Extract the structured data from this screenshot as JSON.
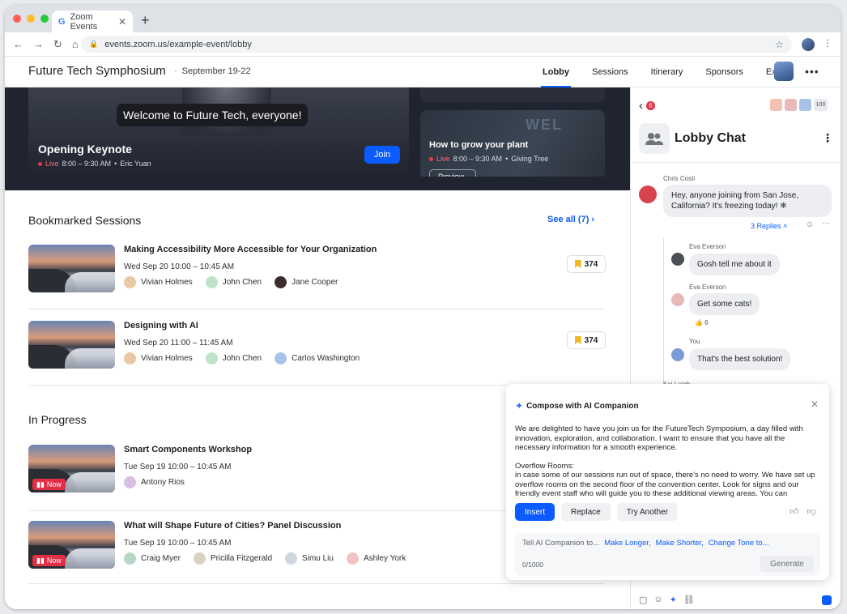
{
  "browser": {
    "tab_title": "Zoom Events",
    "url": "events.zoom.us/example-event/lobby"
  },
  "header": {
    "event_title": "Future Tech Symphosium",
    "event_date": "September 19-22",
    "nav": [
      "Lobby",
      "Sessions",
      "Itinerary",
      "Sponsors",
      "Expo"
    ]
  },
  "hero": {
    "caption": "Welcome to Future Tech, everyone!",
    "title": "Opening Keynote",
    "live": "Live",
    "time": "8:00 – 9:30 AM",
    "host": "Eric Yuan",
    "join_label": "Join",
    "side_title": "How to grow your plant",
    "side_time": "8:00 – 9:30 AM",
    "side_host": "Giving Tree",
    "side_button": "Preview",
    "side_watermark": "WEL"
  },
  "bookmarked": {
    "title": "Bookmarked Sessions",
    "see_all": "See all (7)",
    "items": [
      {
        "title": "Making Accessibility More Accessible for Your Organization",
        "date": "Wed Sep 20 10:00 – 10:45 AM",
        "count": "374",
        "people": [
          "Vivian Holmes",
          "John Chen",
          "Jane Cooper"
        ]
      },
      {
        "title": "Designing with AI",
        "date": "Wed Sep 20 11:00 – 11:45 AM",
        "count": "374",
        "people": [
          "Vivian Holmes",
          "John Chen",
          "Carlos Washington"
        ]
      }
    ]
  },
  "in_progress": {
    "title": "In Progress",
    "now_label": "Now",
    "items": [
      {
        "title": "Smart Components Workshop",
        "date": "Tue Sep 19 10:00 – 10:45 AM",
        "people": [
          "Antony Rios"
        ]
      },
      {
        "title": "What will Shape Future of Cities? Panel Discussion",
        "date": "Tue Sep 19 10:00 – 10:45 AM",
        "people": [
          "Craig Myer",
          "Pricilla Fitzgerald",
          "Simu Liu",
          "Ashley York"
        ]
      }
    ]
  },
  "chat": {
    "unread": "6",
    "member_count": "100",
    "name": "Lobby Chat",
    "messages": {
      "m1_sender": "Chris Costi",
      "m1_text": "Hey, anyone joining from San Jose, California? It's freezing today! ❄",
      "replies": "3 Replies ˄",
      "m2_sender": "Eva Everson",
      "m2_text": "Gosh tell me about it",
      "m3_sender": "Eva Everson",
      "m3_text": "Get some cats!",
      "m3_reaction": "👍 6",
      "m4_sender": "You",
      "m4_text": "That's the best solution!",
      "m5_sender": "Kei Leigh"
    }
  },
  "ai": {
    "title": "Compose with AI Companion",
    "para1": "We are delighted to have you join us for the FutureTech Symposium, a day filled with innovation, exploration, and collaboration. I want to ensure that you have all the necessary information for a smooth experience.",
    "para2_head": "Overflow Rooms:",
    "para2": "in case some of our sessions run out of space, there's no need to worry. We have set up overflow rooms on the second floor of the convention center. Look for signs and our friendly event staff who will guide you to these additional viewing areas. You can",
    "insert": "Insert",
    "replace": "Replace",
    "try_another": "Try Another",
    "prompt": "Tell AI Companion to...",
    "sugg1": "Make Longer,",
    "sugg2": "Make Shorter,",
    "sugg3": "Change Tone to...",
    "counter": "0/1000",
    "generate": "Generate"
  },
  "colors": {
    "accent": "#0b5cff",
    "live_red": "#e22f46",
    "bookmark": "#f2b824"
  }
}
